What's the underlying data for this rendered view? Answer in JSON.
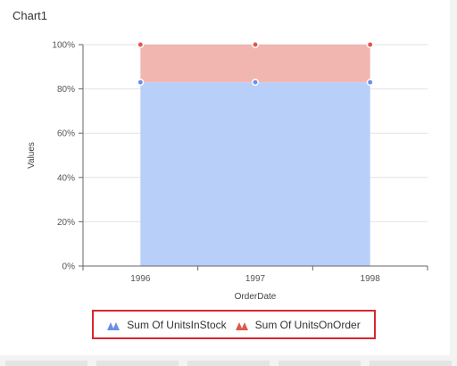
{
  "chart_title": "Chart1",
  "chart_data": {
    "type": "area",
    "stacking": "100%",
    "x": [
      "1996",
      "1997",
      "1998"
    ],
    "series": [
      {
        "name": "Sum Of UnitsInStock",
        "values": [
          83,
          83,
          83
        ],
        "color": "#b8cffa",
        "marker_color": "#6b8fe8"
      },
      {
        "name": "Sum Of UnitsOnOrder",
        "values": [
          17,
          17,
          17
        ],
        "color": "#f2b6b0",
        "marker_color": "#e0584c"
      }
    ],
    "xlabel": "OrderDate",
    "ylabel": "Values",
    "ylim": [
      0,
      100
    ],
    "yticks": [
      "0%",
      "20%",
      "40%",
      "60%",
      "80%",
      "100%"
    ],
    "grid": true,
    "legend_position": "bottom"
  },
  "legend": {
    "items": [
      {
        "label": "Sum Of UnitsInStock",
        "color": "#6b8fe8"
      },
      {
        "label": "Sum Of UnitsOnOrder",
        "color": "#e0584c"
      }
    ]
  }
}
